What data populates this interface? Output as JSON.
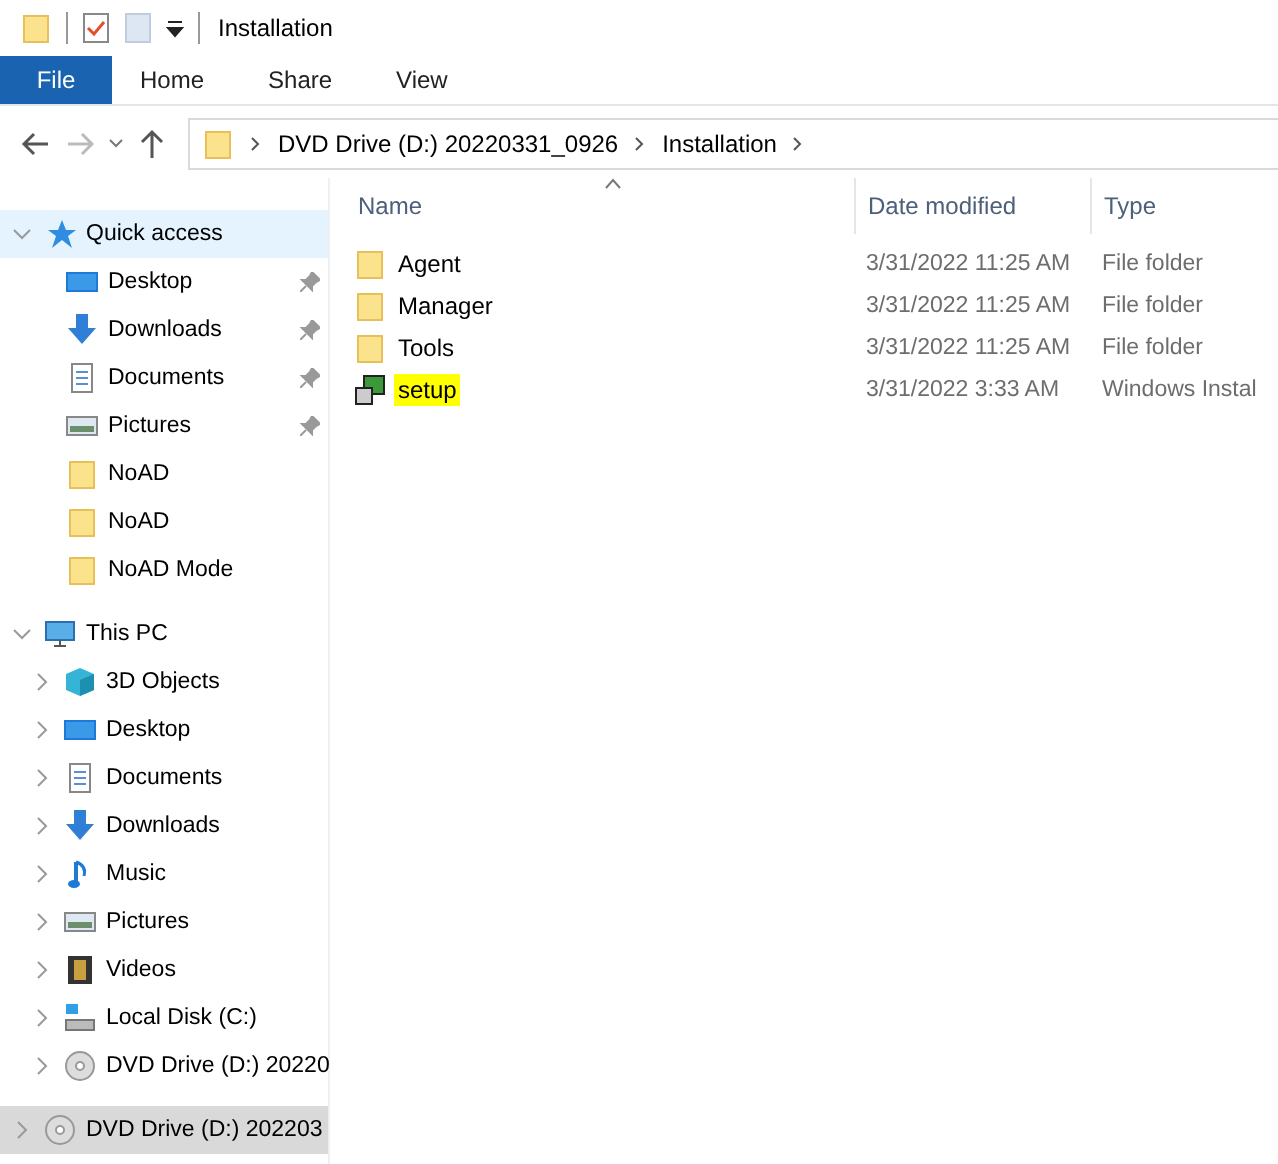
{
  "window": {
    "title": "Installation"
  },
  "ribbon": {
    "tabs": [
      {
        "label": "File",
        "selected": true
      },
      {
        "label": "Home",
        "selected": false
      },
      {
        "label": "Share",
        "selected": false
      },
      {
        "label": "View",
        "selected": false
      }
    ]
  },
  "address": {
    "crumbs": [
      "DVD Drive (D:) 20220331_0926",
      "Installation"
    ]
  },
  "sidebar": {
    "items": [
      {
        "label": "Quick access",
        "kind": "star",
        "expanded": true,
        "hovered": true,
        "selected": false,
        "children": [
          {
            "label": "Desktop",
            "kind": "desktop",
            "pinned": true
          },
          {
            "label": "Downloads",
            "kind": "downloads",
            "pinned": true
          },
          {
            "label": "Documents",
            "kind": "documents",
            "pinned": true
          },
          {
            "label": "Pictures",
            "kind": "pictures",
            "pinned": true
          },
          {
            "label": "NoAD",
            "kind": "folder",
            "pinned": false
          },
          {
            "label": "NoAD",
            "kind": "folder",
            "pinned": false
          },
          {
            "label": "NoAD Mode",
            "kind": "folder",
            "pinned": false
          }
        ]
      },
      {
        "label": "This PC",
        "kind": "pc",
        "expanded": true,
        "hovered": false,
        "selected": false,
        "children": [
          {
            "label": "3D Objects",
            "kind": "cube",
            "expanded": false
          },
          {
            "label": "Desktop",
            "kind": "desktop",
            "expanded": false
          },
          {
            "label": "Documents",
            "kind": "documents",
            "expanded": false
          },
          {
            "label": "Downloads",
            "kind": "downloads",
            "expanded": false
          },
          {
            "label": "Music",
            "kind": "music",
            "expanded": false
          },
          {
            "label": "Pictures",
            "kind": "pictures",
            "expanded": false
          },
          {
            "label": "Videos",
            "kind": "videos",
            "expanded": false
          },
          {
            "label": "Local Disk (C:)",
            "kind": "disk",
            "expanded": false
          },
          {
            "label": "DVD Drive (D:) 20220",
            "kind": "dvd",
            "expanded": false
          }
        ]
      },
      {
        "label": "DVD Drive (D:) 202203",
        "kind": "dvd",
        "expanded": false,
        "hovered": false,
        "selected": true
      }
    ]
  },
  "table": {
    "columns": [
      "Name",
      "Date modified",
      "Type"
    ],
    "rows": [
      {
        "name": "Agent",
        "kind": "folder",
        "date": "3/31/2022 11:25 AM",
        "type": "File folder",
        "highlighted": false
      },
      {
        "name": "Manager",
        "kind": "folder",
        "date": "3/31/2022 11:25 AM",
        "type": "File folder",
        "highlighted": false
      },
      {
        "name": "Tools",
        "kind": "folder",
        "date": "3/31/2022 11:25 AM",
        "type": "File folder",
        "highlighted": false
      },
      {
        "name": "setup",
        "kind": "installer",
        "date": "3/31/2022 3:33 AM",
        "type": "Windows Instal",
        "highlighted": true
      }
    ]
  }
}
